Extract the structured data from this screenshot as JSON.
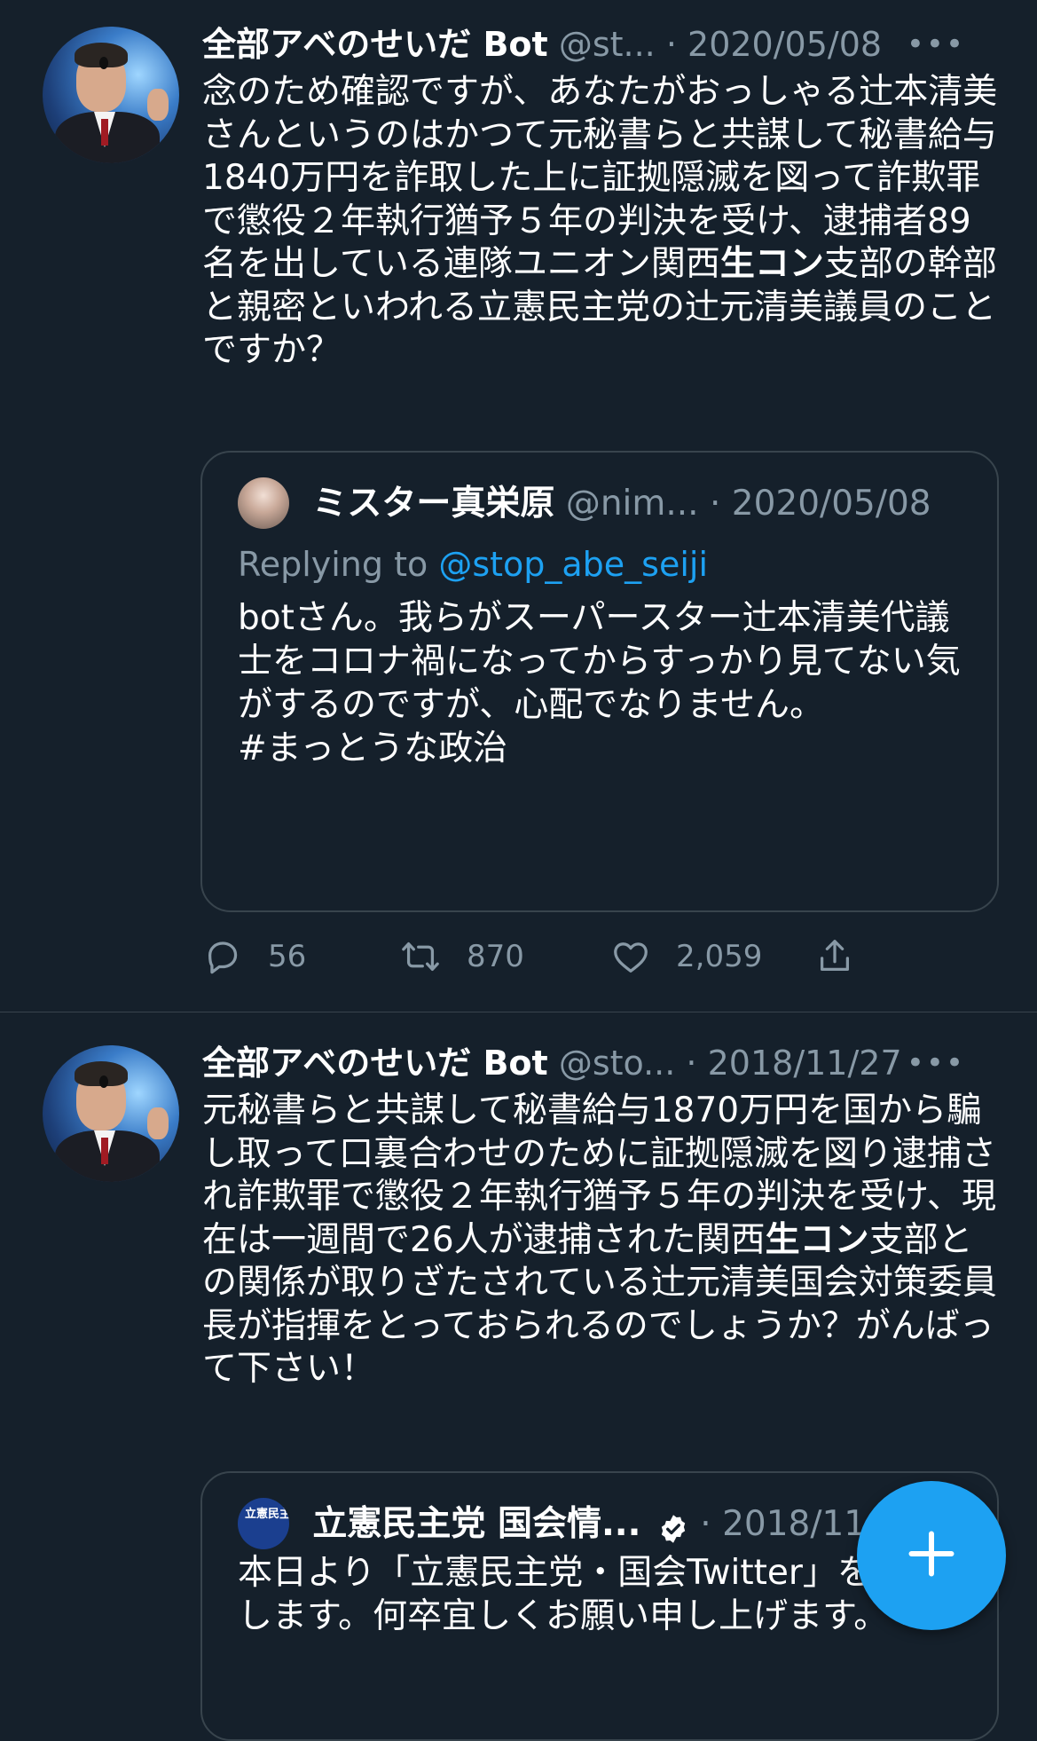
{
  "tweets": [
    {
      "author_name": "全部アベのせいだ Bot",
      "handle": "@st...",
      "separator": "·",
      "date": "2020/05/08",
      "more_icon": "more-horizontal-icon",
      "text_part1": "念のため確認ですが、あなたがおっしゃる辻本清美さんというのはかつて元秘書らと共謀して秘書給与1840万円を詐取した上に証拠隠滅を図って詐欺罪で懲役２年執行猶予５年の判決を受け、逮捕者89名を出している連隊ユニオン関西",
      "text_bold": "生コン",
      "text_part2": "支部の幹部と親密といわれる立憲民主党の辻元清美議員のことですか？",
      "quote": {
        "author_name": "ミスター真栄原",
        "handle": "@nim...",
        "separator": "·",
        "date": "2020/05/08",
        "replying_to_label": "Replying to",
        "replying_to_handle": "@stop_abe_seiji",
        "text": "botさん。我らがスーパースター辻本清美代議士をコロナ禍になってからすっかり見てない気がするのですが、心配でなりません。\n#まっとうな政治"
      },
      "actions": {
        "reply_count": "56",
        "retweet_count": "870",
        "like_count": "2,059"
      }
    },
    {
      "author_name": "全部アベのせいだ Bot",
      "handle": "@sto...",
      "separator": "·",
      "date": "2018/11/27",
      "text_part1": "元秘書らと共謀して秘書給与1870万円を国から騙し取って口裏合わせのために証拠隠滅を図り逮捕され詐欺罪で懲役２年執行猶予５年の判決を受け、現在は一週間で26人が逮捕された関西",
      "text_bold": "生コン",
      "text_part2": "支部との関係が取りざたされている辻元清美国会対策委員長が指揮をとっておられるのでしょうか？がんばって下さい！",
      "quote": {
        "avatar_text": "立憲民主党 国会",
        "author_name": "立憲民主党 国会情...",
        "separator": "·",
        "date": "2018/11/",
        "text": "本日より「立憲民主党・国会Twitter」を開始します。何卒宜しくお願い申し上げます。"
      }
    }
  ],
  "fab_icon": "plus-icon",
  "colors": {
    "background": "#15202b",
    "secondary_text": "#8899a6",
    "accent": "#1da1f2",
    "border": "#38444d"
  }
}
